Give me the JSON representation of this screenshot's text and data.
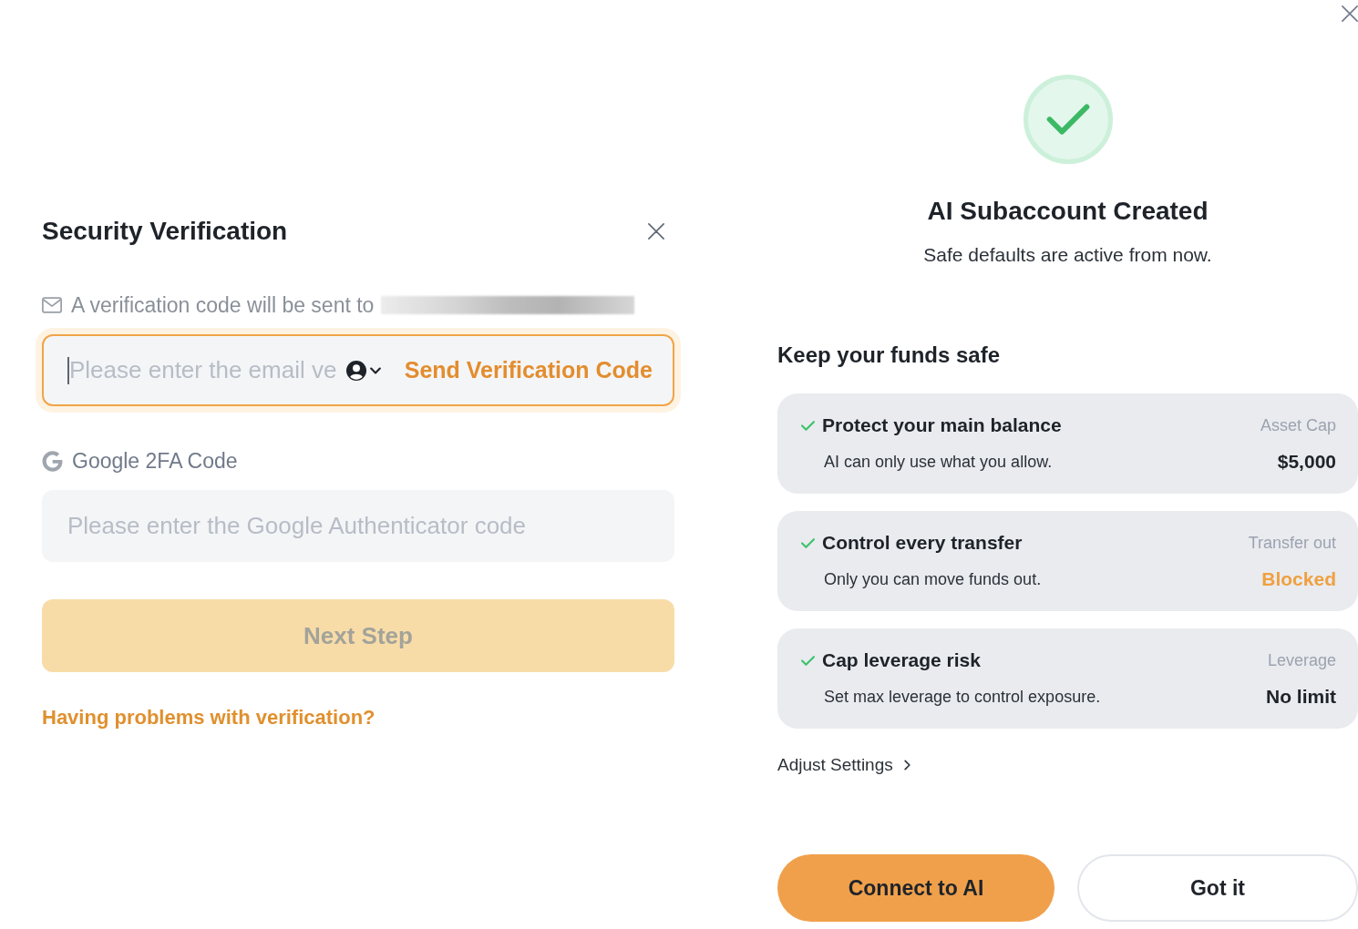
{
  "verification_dialog": {
    "title": "Security Verification",
    "email_notice": "A verification code will be sent to",
    "email_code_field": {
      "placeholder": "Please enter the email ve",
      "focused": true,
      "send_button": "Send Verification Code"
    },
    "google_label": "Google 2FA Code",
    "google_code_field": {
      "placeholder": "Please enter the Google Authenticator code",
      "focused": false
    },
    "next_button": {
      "label": "Next Step",
      "disabled": true
    },
    "help_link": "Having problems with verification?"
  },
  "success_panel": {
    "title": "AI Subaccount Created",
    "subtitle": "Safe defaults are active from now.",
    "section_title": "Keep your funds safe",
    "safeguards": [
      {
        "title": "Protect your main balance",
        "description": "AI can only use what you allow.",
        "setting_label": "Asset Cap",
        "setting_value": "$5,000",
        "highlighted": false
      },
      {
        "title": "Control every transfer",
        "description": "Only you can move funds out.",
        "setting_label": "Transfer out",
        "setting_value": "Blocked",
        "highlighted": true
      },
      {
        "title": "Cap leverage risk",
        "description": "Set max leverage to control exposure.",
        "setting_label": "Leverage",
        "setting_value": "No limit",
        "highlighted": false
      }
    ],
    "adjust_link": "Adjust Settings",
    "buttons": [
      {
        "label": "Connect to AI",
        "kind": "primary"
      },
      {
        "label": "Got it",
        "kind": "secondary"
      }
    ]
  }
}
